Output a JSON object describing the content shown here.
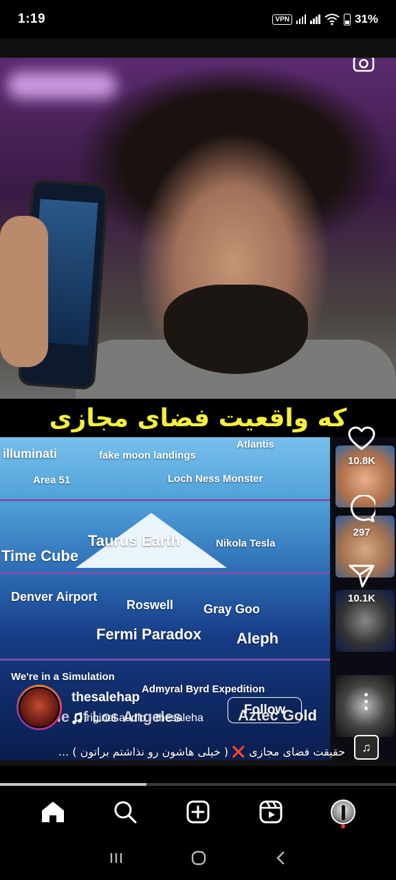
{
  "status_bar": {
    "time": "1:19",
    "vpn": "VPN",
    "battery": "31%"
  },
  "video": {
    "banner_text": "که واقعیت فضای مجازی",
    "iceberg_labels": [
      "illuminati",
      "fake moon landings",
      "Atlantis",
      "Area 51",
      "Loch Ness Monster",
      "Taurus Earth",
      "Time Cube",
      "Nikola Tesla",
      "Denver Airport",
      "Roswell",
      "Gray Goo",
      "Fermi Paradox",
      "Aleph",
      "We're in a Simulation",
      "Admyral Byrd Expedition",
      "Battle of Los Angeles",
      "Aztec Gold"
    ]
  },
  "actions": {
    "likes": "10.8K",
    "comments": "297",
    "shares": "10.1K"
  },
  "author": {
    "username": "thesalehap",
    "audio_text": "riginal audio · thesaleha",
    "follow_label": "Follow"
  },
  "caption": "حقیقت فضای مجازی ❌ ( خیلی هاشون رو نذاشتم براتون ) ...",
  "progress": 0.37,
  "icons": {
    "camera": "camera-icon",
    "like": "heart-icon",
    "comment": "comment-icon",
    "share": "send-icon",
    "more": "more-vertical-icon",
    "audio": "music-note-icon"
  },
  "nav": [
    "home-icon",
    "search-icon",
    "create-icon",
    "reels-icon",
    "profile-icon"
  ]
}
